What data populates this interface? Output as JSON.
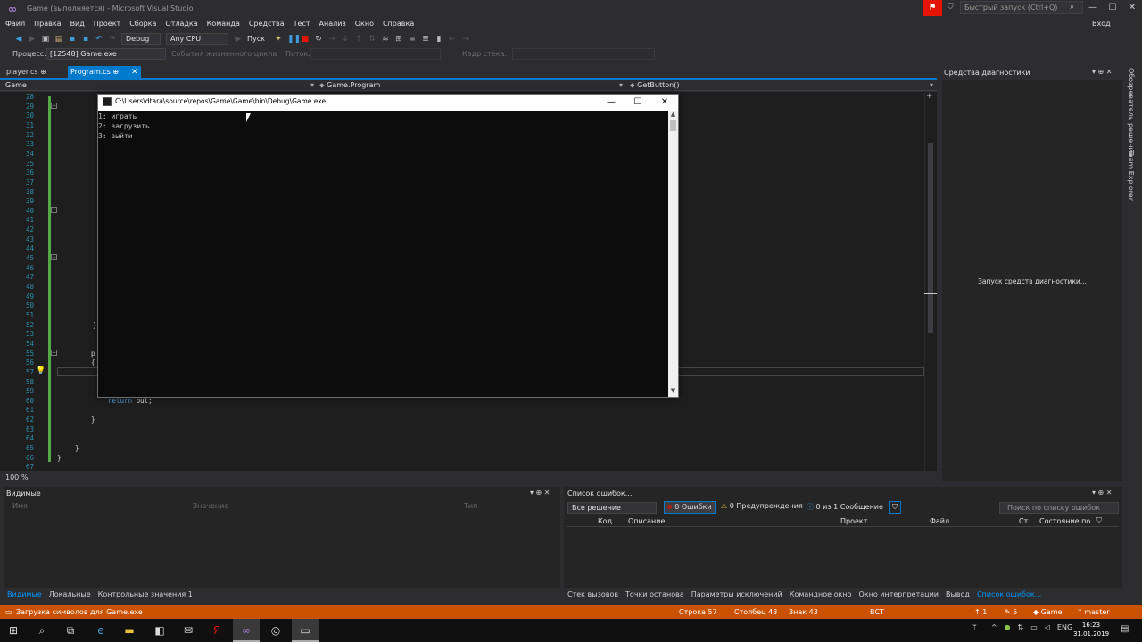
{
  "window": {
    "title": "Game (выполняется) - Microsoft Visual Studio",
    "quick_launch_placeholder": "Быстрый запуск (Ctrl+Q)",
    "sign_in": "Вход",
    "minimize": "—",
    "maximize": "☐",
    "close": "✕"
  },
  "menu": [
    "Файл",
    "Правка",
    "Вид",
    "Проект",
    "Сборка",
    "Отладка",
    "Команда",
    "Средства",
    "Тест",
    "Анализ",
    "Окно",
    "Справка"
  ],
  "toolbar": {
    "config": "Debug",
    "platform": "Any CPU",
    "start": "Пуск"
  },
  "process_bar": {
    "label": "Процесс:",
    "process": "[12548] Game.exe",
    "lifecycle": "События жизненного цикла",
    "thread_label": "Поток:",
    "stack_label": "Кадр стека:"
  },
  "tabs": [
    {
      "label": "player.cs",
      "pin": "⊕"
    },
    {
      "label": "Program.cs",
      "pin": "⊕"
    }
  ],
  "navbar": {
    "project": "Game",
    "class": "Game.Program",
    "member": "GetButton()"
  },
  "editor": {
    "line_numbers": [
      "28",
      "29",
      "30",
      "31",
      "32",
      "33",
      "34",
      "35",
      "36",
      "37",
      "38",
      "39",
      "40",
      "41",
      "42",
      "43",
      "44",
      "45",
      "46",
      "47",
      "48",
      "49",
      "50",
      "51",
      "52",
      "53",
      "54",
      "55",
      "56",
      "57",
      "58",
      "59",
      "60",
      "61",
      "62",
      "63",
      "64",
      "65",
      "66",
      "67"
    ],
    "code_lines": [
      {
        "line": "52",
        "text": "}"
      },
      {
        "line": "55",
        "text": "p"
      },
      {
        "line": "56",
        "text": "{"
      },
      {
        "line": "60",
        "text": "return but;"
      },
      {
        "line": "62",
        "text": "}"
      },
      {
        "line": "65",
        "text": "}"
      },
      {
        "line": "66",
        "text": "}"
      }
    ],
    "zoom": "100 %"
  },
  "console": {
    "title": "C:\\Users\\dtara\\source\\repos\\Game\\Game\\bin\\Debug\\Game.exe",
    "lines": [
      "1: играть",
      "2: загрузить",
      "3: выйти"
    ]
  },
  "diagnostics": {
    "title": "Средства диагностики",
    "message": "Запуск средств диагностики...",
    "side_tabs": [
      "Обозреватель решений",
      "Team Explorer"
    ]
  },
  "watch": {
    "title": "Видимые",
    "columns": [
      "Имя",
      "Значение",
      "Тип"
    ],
    "tabs": [
      "Видимые",
      "Локальные",
      "Контрольные значения 1"
    ]
  },
  "errors": {
    "title": "Список ошибок...",
    "scope": "Все решение",
    "errors_btn": "0 Ошибки",
    "warnings_btn": "0 Предупреждения",
    "messages_btn": "0 из 1 Сообщение",
    "search_placeholder": "Поиск по списку ошибок",
    "columns": [
      "Код",
      "Описание",
      "Проект",
      "Файл",
      "Ст...",
      "Состояние по..."
    ],
    "tabs": [
      "Стек вызовов",
      "Точки останова",
      "Параметры исключений",
      "Командное окно",
      "Окно интерпретации",
      "Вывод",
      "Список ошибок..."
    ]
  },
  "status": {
    "message": "Загрузка символов для Game.exe",
    "line": "Строка 57",
    "col": "Столбец 43",
    "char": "Знак 43",
    "mode": "ВСТ",
    "up_count": "1",
    "edit_count": "5",
    "repo": "Game",
    "branch": "master"
  },
  "taskbar": {
    "lang": "ENG",
    "time": "16:23",
    "date": "31.01.2019"
  },
  "colors": {
    "accent": "#007acc",
    "status_debug": "#ca5100",
    "editor_bg": "#1e1e1e"
  }
}
